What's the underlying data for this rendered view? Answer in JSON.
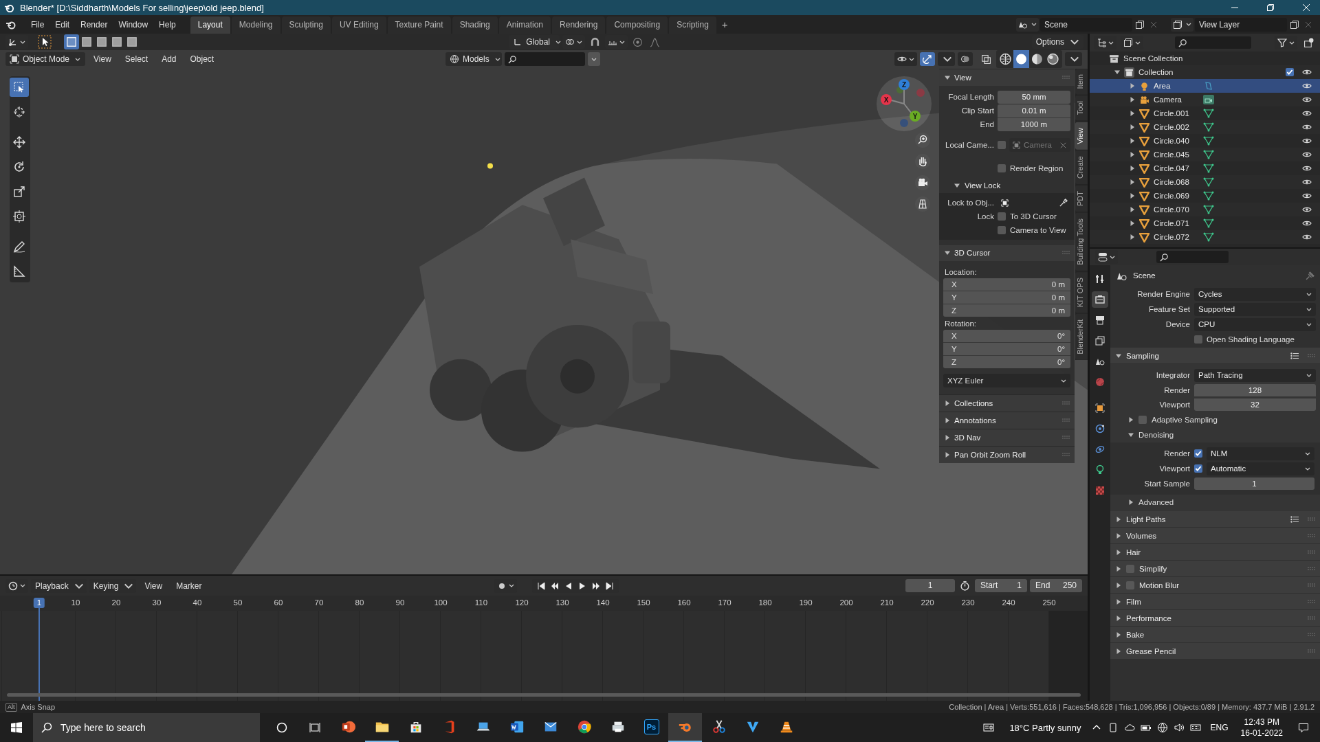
{
  "window": {
    "title": "Blender* [D:\\Siddharth\\Models For selling\\jeep\\old jeep.blend]"
  },
  "menu": [
    "File",
    "Edit",
    "Render",
    "Window",
    "Help"
  ],
  "workspaces": [
    {
      "label": "Layout",
      "selected": true
    },
    {
      "label": "Modeling",
      "selected": false
    },
    {
      "label": "Sculpting",
      "selected": false
    },
    {
      "label": "UV Editing",
      "selected": false
    },
    {
      "label": "Texture Paint",
      "selected": false
    },
    {
      "label": "Shading",
      "selected": false
    },
    {
      "label": "Animation",
      "selected": false
    },
    {
      "label": "Rendering",
      "selected": false
    },
    {
      "label": "Compositing",
      "selected": false
    },
    {
      "label": "Scripting",
      "selected": false
    }
  ],
  "add_workspace": "+",
  "scene": {
    "name": "Scene"
  },
  "view_layer": {
    "name": "View Layer"
  },
  "viewport": {
    "orientation": "Global",
    "options": "Options",
    "mode": "Object Mode",
    "menus": [
      "View",
      "Select",
      "Add",
      "Object"
    ],
    "collection": "Models",
    "tools": [
      {
        "kind": "select",
        "selected": true
      },
      {
        "kind": "cursor",
        "selected": false
      },
      {
        "kind": "move",
        "selected": false
      },
      {
        "kind": "rotate",
        "selected": false
      },
      {
        "kind": "scale",
        "selected": false
      },
      {
        "kind": "transform",
        "selected": false
      },
      {
        "kind": "annotate",
        "selected": false
      },
      {
        "kind": "measure",
        "selected": false
      }
    ],
    "shading": [
      {
        "kind": "wireframe",
        "selected": false
      },
      {
        "kind": "solid",
        "selected": true
      },
      {
        "kind": "material",
        "selected": false
      },
      {
        "kind": "rendered",
        "selected": false
      }
    ],
    "gizmo_axes": [
      "Z",
      "X",
      "Y"
    ]
  },
  "sidebar": {
    "tabs": [
      {
        "label": "Item",
        "selected": false
      },
      {
        "label": "Tool",
        "selected": false
      },
      {
        "label": "View",
        "selected": true
      },
      {
        "label": "Create",
        "selected": false
      },
      {
        "label": "PDT",
        "selected": false
      },
      {
        "label": "Building Tools",
        "selected": false
      },
      {
        "label": "KIT OPS",
        "selected": false
      },
      {
        "label": "BlenderKit",
        "selected": false
      }
    ],
    "view_panel": {
      "title": "View",
      "expanded": true,
      "fields": [
        {
          "label": "Focal Length",
          "value": "50 mm"
        },
        {
          "label": "Clip Start",
          "value": "0.01 m"
        },
        {
          "label": "End",
          "value": "1000 m"
        }
      ],
      "local_camera": {
        "label": "Local Came...",
        "checked": false,
        "object": "Camera"
      },
      "render_region": {
        "label": "Render Region",
        "checked": false
      },
      "view_lock": {
        "title": "View Lock",
        "expanded": true,
        "lock_object": "Lock to Obj...",
        "lock": "Lock",
        "options": [
          {
            "label": "To 3D Cursor",
            "checked": false
          },
          {
            "label": "Camera to View",
            "checked": false
          }
        ]
      }
    },
    "cursor_panel": {
      "title": "3D Cursor",
      "expanded": true,
      "location": {
        "label": "Location:",
        "values": [
          {
            "axis": "X",
            "value": "0 m"
          },
          {
            "axis": "Y",
            "value": "0 m"
          },
          {
            "axis": "Z",
            "value": "0 m"
          }
        ]
      },
      "rotation": {
        "label": "Rotation:",
        "values": [
          {
            "axis": "X",
            "value": "0°"
          },
          {
            "axis": "Y",
            "value": "0°"
          },
          {
            "axis": "Z",
            "value": "0°"
          }
        ]
      },
      "mode": "XYZ Euler"
    },
    "more_panels": [
      {
        "title": "Collections",
        "expanded": false
      },
      {
        "title": "Annotations",
        "expanded": false
      },
      {
        "title": "3D Nav",
        "expanded": false
      },
      {
        "title": "Pan Orbit Zoom Roll",
        "expanded": false
      }
    ]
  },
  "outliner": {
    "root": "Scene Collection",
    "collection": {
      "name": "Collection",
      "expanded": true,
      "checked": true,
      "children": [
        {
          "name": "Area",
          "kind": "light",
          "selected": true
        },
        {
          "name": "Camera",
          "kind": "camera",
          "selected": false
        },
        {
          "name": "Circle.001",
          "kind": "mesh",
          "selected": false
        },
        {
          "name": "Circle.002",
          "kind": "mesh",
          "selected": false
        },
        {
          "name": "Circle.040",
          "kind": "mesh",
          "selected": false
        },
        {
          "name": "Circle.045",
          "kind": "mesh",
          "selected": false
        },
        {
          "name": "Circle.047",
          "kind": "mesh",
          "selected": false
        },
        {
          "name": "Circle.068",
          "kind": "mesh",
          "selected": false
        },
        {
          "name": "Circle.069",
          "kind": "mesh",
          "selected": false
        },
        {
          "name": "Circle.070",
          "kind": "mesh",
          "selected": false
        },
        {
          "name": "Circle.071",
          "kind": "mesh",
          "selected": false
        },
        {
          "name": "Circle.072",
          "kind": "mesh",
          "selected": false
        }
      ]
    }
  },
  "properties": {
    "tabs": [
      {
        "kind": "tool",
        "selected": false
      },
      {
        "kind": "render",
        "selected": true
      },
      {
        "kind": "output",
        "selected": false
      },
      {
        "kind": "view_layer",
        "selected": false
      },
      {
        "kind": "scene",
        "selected": false
      },
      {
        "kind": "world",
        "selected": false
      },
      {
        "kind": "object",
        "selected": false
      },
      {
        "kind": "particles",
        "selected": false
      },
      {
        "kind": "physics",
        "selected": false
      },
      {
        "kind": "data",
        "selected": false
      },
      {
        "kind": "texture",
        "selected": false
      }
    ],
    "context": "Scene",
    "fields": [
      {
        "label": "Render Engine",
        "value": "Cycles"
      },
      {
        "label": "Feature Set",
        "value": "Supported"
      },
      {
        "label": "Device",
        "value": "CPU"
      }
    ],
    "osl": {
      "label": "Open Shading Language",
      "checked": false
    },
    "sampling": {
      "title": "Sampling",
      "expanded": true,
      "integrator": {
        "label": "Integrator",
        "value": "Path Tracing"
      },
      "samples": [
        {
          "label": "Render",
          "value": "128"
        },
        {
          "label": "Viewport",
          "value": "32"
        }
      ],
      "adaptive": {
        "title": "Adaptive Sampling",
        "expanded": false,
        "checked": false
      },
      "denoising": {
        "title": "Denoising",
        "expanded": true,
        "rows": [
          {
            "label": "Render",
            "checked": true,
            "value": "NLM"
          },
          {
            "label": "Viewport",
            "checked": true,
            "value": "Automatic"
          }
        ],
        "start_sample": {
          "label": "Start Sample",
          "value": "1"
        }
      },
      "advanced": {
        "title": "Advanced",
        "expanded": false
      }
    },
    "panels": [
      {
        "title": "Light Paths",
        "kind": "preset",
        "expanded": false
      },
      {
        "title": "Volumes",
        "kind": "plain",
        "expanded": false
      },
      {
        "title": "Hair",
        "kind": "plain",
        "expanded": false
      },
      {
        "title": "Simplify",
        "kind": "check",
        "checked": false,
        "expanded": false
      },
      {
        "title": "Motion Blur",
        "kind": "check",
        "checked": false,
        "expanded": false
      },
      {
        "title": "Film",
        "kind": "plain",
        "expanded": false
      },
      {
        "title": "Performance",
        "kind": "plain",
        "expanded": false
      },
      {
        "title": "Bake",
        "kind": "plain",
        "expanded": false
      },
      {
        "title": "Grease Pencil",
        "kind": "plain",
        "expanded": false
      }
    ]
  },
  "timeline": {
    "menus": [
      {
        "label": "Playback",
        "kind": "dropdown"
      },
      {
        "label": "Keying",
        "kind": "dropdown"
      },
      {
        "label": "View",
        "kind": "menu"
      },
      {
        "label": "Marker",
        "kind": "menu"
      }
    ],
    "current_frame": "1",
    "start": {
      "label": "Start",
      "value": "1"
    },
    "end": {
      "label": "End",
      "value": "250"
    },
    "ticks": [
      "1",
      "10",
      "20",
      "30",
      "40",
      "50",
      "60",
      "70",
      "80",
      "90",
      "100",
      "110",
      "120",
      "130",
      "140",
      "150",
      "160",
      "170",
      "180",
      "190",
      "200",
      "210",
      "220",
      "230",
      "240",
      "250"
    ]
  },
  "status_bar": {
    "hint_key": "Alt",
    "hint": "Axis Snap",
    "stats": "Collection | Area | Verts:551,616 | Faces:548,628 | Tris:1,096,956 | Objects:0/89 | Memory: 437.7 MiB | 2.91.2"
  },
  "taskbar": {
    "search": {
      "placeholder": "Type here to search"
    },
    "apps": [
      {
        "kind": "powerpoint",
        "running": false,
        "selected": false
      },
      {
        "kind": "explorer",
        "running": true,
        "selected": false
      },
      {
        "kind": "store",
        "running": false,
        "selected": false
      },
      {
        "kind": "office",
        "running": false,
        "selected": false
      },
      {
        "kind": "laptop",
        "running": false,
        "selected": false
      },
      {
        "kind": "word",
        "running": false,
        "selected": false
      },
      {
        "kind": "mail",
        "running": false,
        "selected": false
      },
      {
        "kind": "chrome",
        "running": false,
        "selected": false
      },
      {
        "kind": "printer",
        "running": false,
        "selected": false
      },
      {
        "kind": "photoshop",
        "label": "Ps",
        "running": false,
        "selected": false
      },
      {
        "kind": "blender",
        "running": true,
        "selected": true
      },
      {
        "kind": "scissors",
        "running": false,
        "selected": false
      },
      {
        "kind": "vector",
        "running": false,
        "selected": false
      },
      {
        "kind": "cone",
        "running": false,
        "selected": false
      }
    ],
    "weather": "18°C Partly sunny",
    "language": "ENG",
    "time": "12:43 PM",
    "date": "16-01-2022"
  }
}
